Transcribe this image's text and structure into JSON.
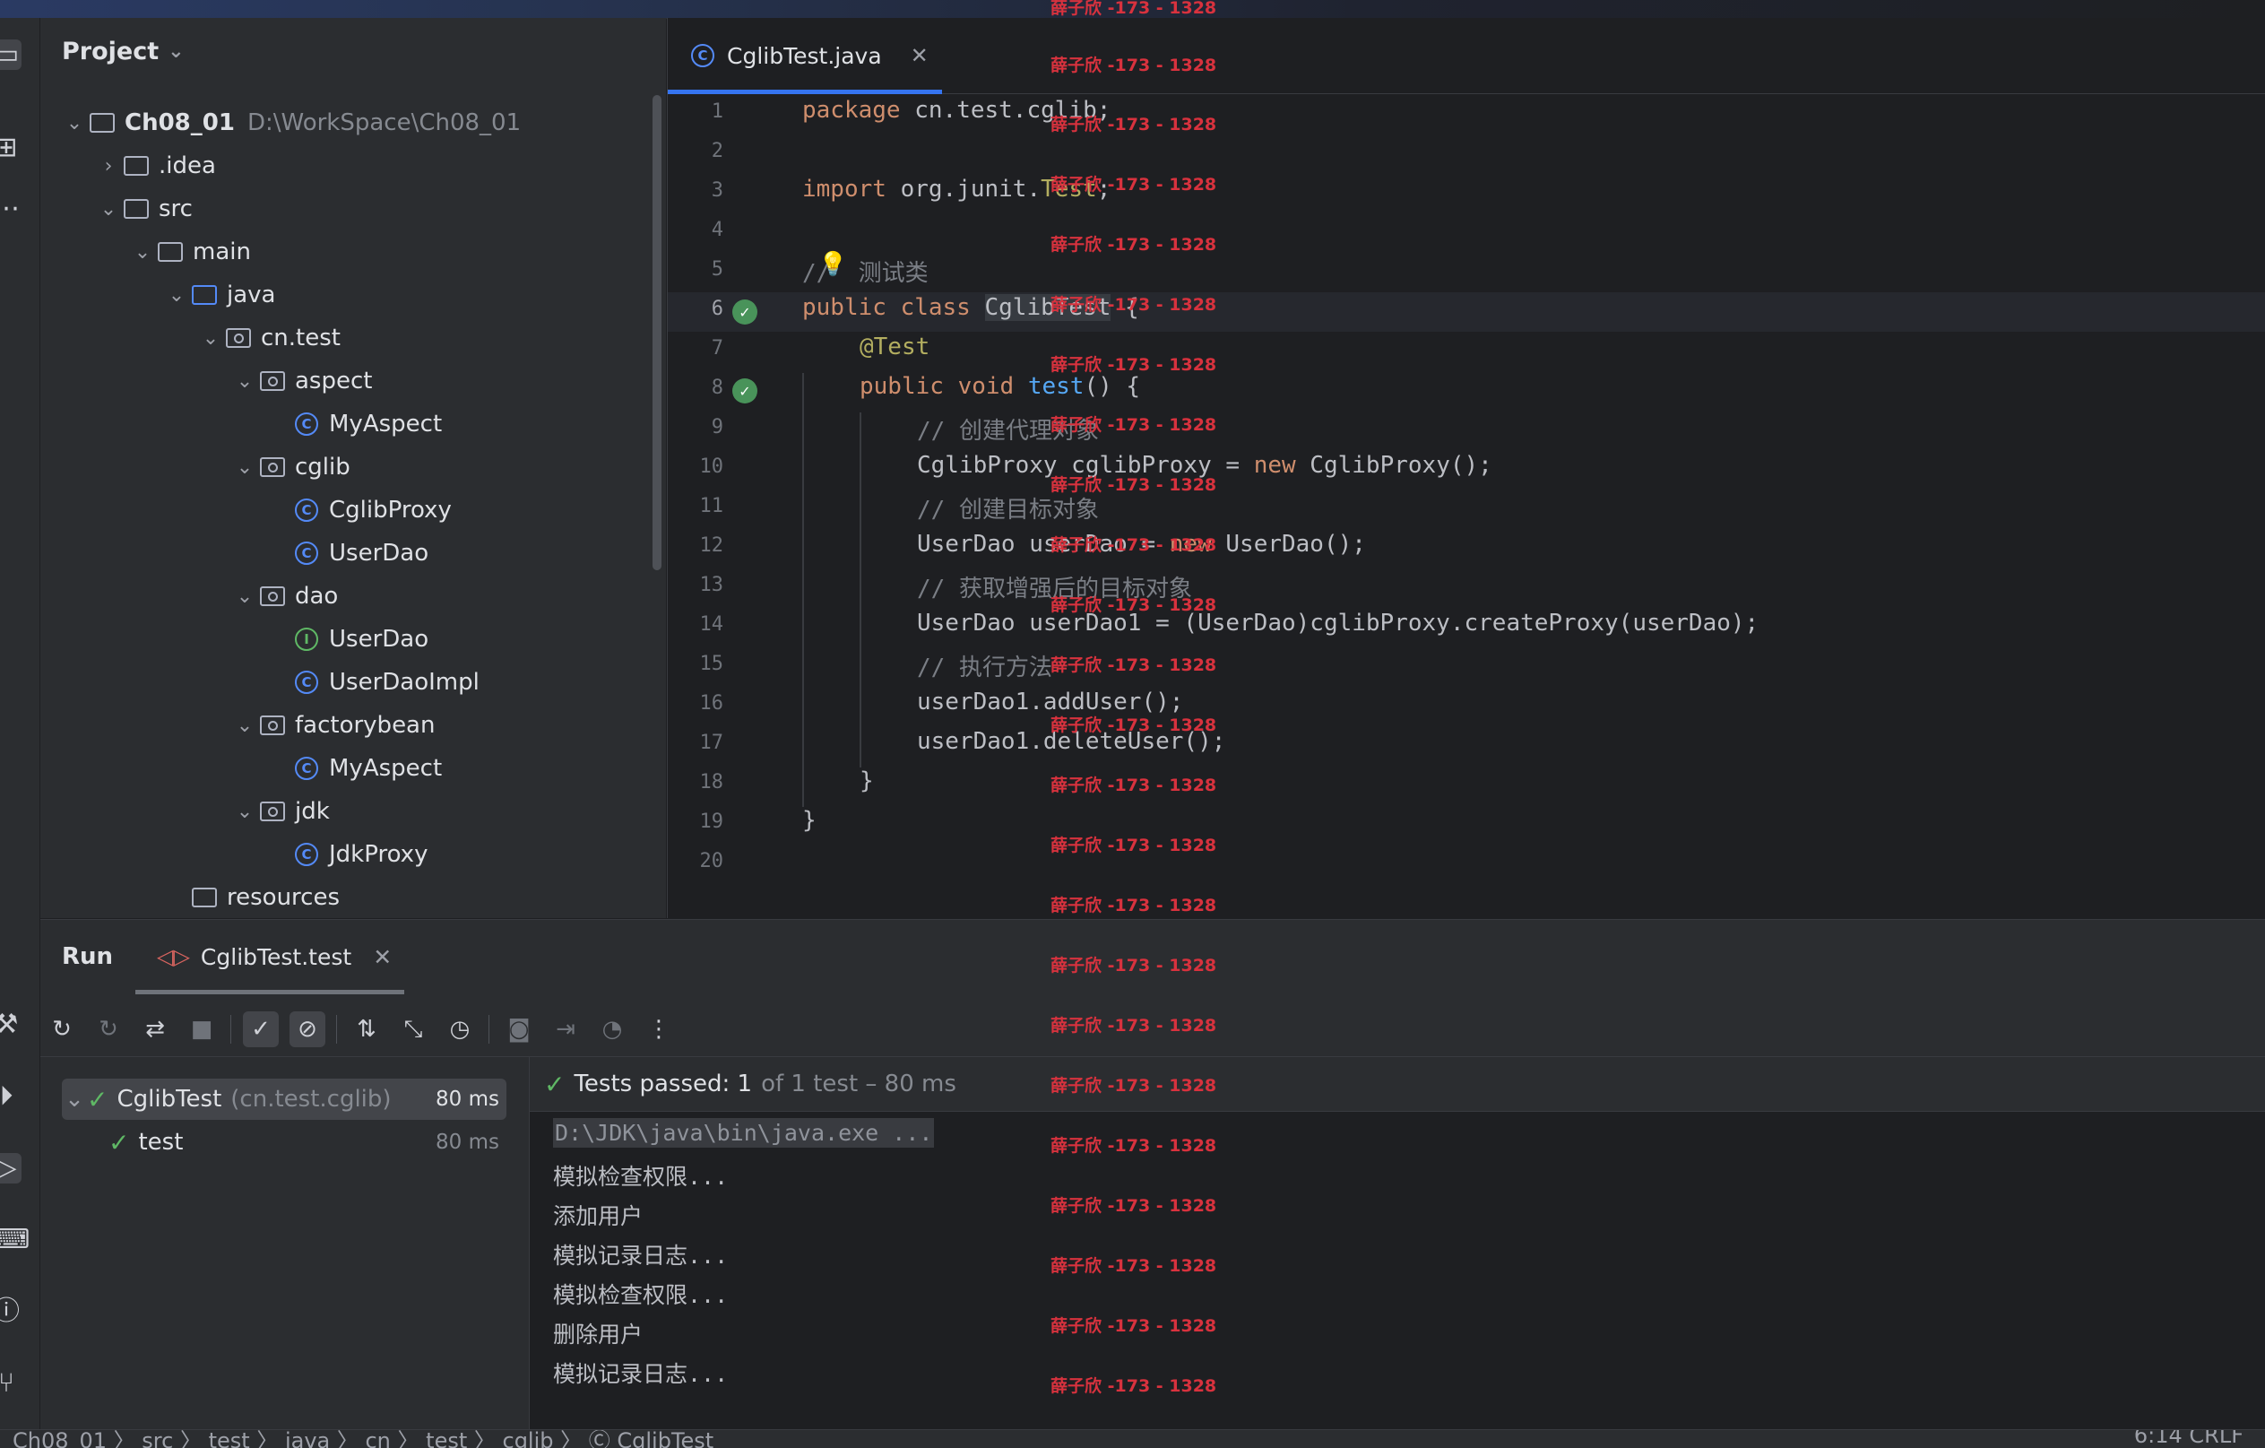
{
  "project": {
    "title": "Project",
    "tree": [
      {
        "label": "Ch08_01",
        "hint": "D:\\WorkSpace\\Ch08_01"
      },
      {
        "label": ".idea"
      },
      {
        "label": "src"
      },
      {
        "label": "main"
      },
      {
        "label": "java"
      },
      {
        "label": "cn.test"
      },
      {
        "label": "aspect"
      },
      {
        "label": "MyAspect"
      },
      {
        "label": "cglib"
      },
      {
        "label": "CglibProxy"
      },
      {
        "label": "UserDao"
      },
      {
        "label": "dao"
      },
      {
        "label": "UserDao"
      },
      {
        "label": "UserDaoImpl"
      },
      {
        "label": "factorybean"
      },
      {
        "label": "MyAspect"
      },
      {
        "label": "jdk"
      },
      {
        "label": "JdkProxy"
      },
      {
        "label": "resources"
      }
    ]
  },
  "editor": {
    "tab": {
      "label": "CglibTest.java"
    },
    "line_numbers": [
      "1",
      "2",
      "3",
      "4",
      "5",
      "6",
      "7",
      "8",
      "9",
      "10",
      "11",
      "12",
      "13",
      "14",
      "15",
      "16",
      "17",
      "18",
      "19",
      "20"
    ],
    "code": {
      "l1_kw": "package",
      "l1_rest": " cn.test.cglib;",
      "l3_kw": "import",
      "l3_rest": " org.junit.",
      "l3_ann": "Test",
      "l3_end": ";",
      "l5_cmt": "//  测试类",
      "l6_kw": "public class",
      "l6_id": "CglibTest",
      "l6_end": " {",
      "l7_ann": "@Test",
      "l8_kw": "public void",
      "l8_fn": "test",
      "l8_end": "() {",
      "l9_cmt": "// 创建代理对象",
      "l10_a": "CglibProxy cglibProxy = ",
      "l10_kw": "new",
      "l10_b": " CglibProxy();",
      "l11_cmt": "// 创建目标对象",
      "l12_a": "UserDao userDao = ",
      "l12_kw": "new",
      "l12_b": " UserDao();",
      "l13_cmt": "// 获取增强后的目标对象",
      "l14": "UserDao userDao1 = (UserDao)cglibProxy.createProxy(userDao);",
      "l15_cmt": "// 执行方法",
      "l16": "userDao1.addUser();",
      "l17": "userDao1.deleteUser();",
      "l18": "}",
      "l19": "}"
    }
  },
  "run": {
    "title": "Run",
    "tab_label": "CglibTest.test",
    "tests": {
      "root_name": "CglibTest",
      "root_pkg": "(cn.test.cglib)",
      "root_duration": "80 ms",
      "child_name": "test",
      "child_duration": "80 ms"
    },
    "status": {
      "passed": "Tests passed: 1",
      "detail": "of 1 test – 80 ms"
    },
    "console": [
      "D:\\JDK\\java\\bin\\java.exe ...",
      "模拟检查权限...",
      "添加用户",
      "模拟记录日志...",
      "模拟检查权限...",
      "删除用户",
      "模拟记录日志..."
    ]
  },
  "watermark": "薛子欣 -173 - 1328",
  "navbar": {
    "crumbs": "Ch08_01 〉 src 〉 test 〉 java 〉 cn 〉 test 〉 cglib 〉 Ⓒ CglibTest",
    "position": "6:14    CRLF"
  },
  "colors": {
    "accent": "#3574f0",
    "pass": "#5fb865",
    "keyword": "#cf8e6d",
    "annotation": "#b3ae60",
    "function": "#56a8f5",
    "comment": "#7a7e85",
    "watermark": "#d8323e"
  }
}
